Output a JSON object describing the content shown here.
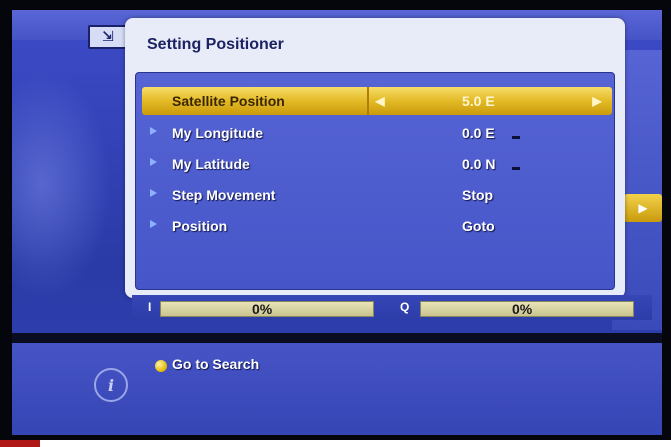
{
  "dialog": {
    "title": "Setting Positioner"
  },
  "menu_icon": "menu-icon",
  "rows": [
    {
      "label": "Satellite Position",
      "value": "5.0 E",
      "selected": true
    },
    {
      "label": "My Longitude",
      "value": "0.0 E",
      "selected": false
    },
    {
      "label": "My Latitude",
      "value": "0.0 N",
      "selected": false
    },
    {
      "label": "Step Movement",
      "value": "Stop",
      "selected": false
    },
    {
      "label": "Position",
      "value": "Goto",
      "selected": false
    }
  ],
  "signal": {
    "level_label": "I",
    "level_pct": "0%",
    "quality_label": "Q",
    "quality_pct": "0%",
    "level_value": 0,
    "quality_value": 0
  },
  "hint": {
    "text": "Go to Search",
    "button_color": "#e2b400"
  },
  "colors": {
    "accent": "#e3ba26",
    "background": "#3040b2",
    "dialog": "#e8ecf9"
  }
}
